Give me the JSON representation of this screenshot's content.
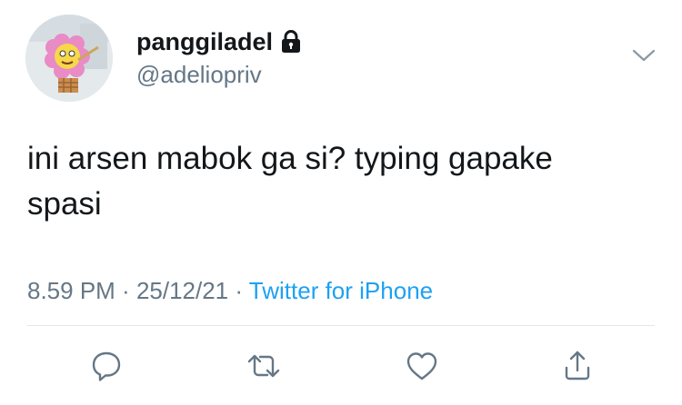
{
  "tweet": {
    "display_name": "panggiladel",
    "username": "@adeliopriv",
    "text_line1": "ini arsen mabok ga si? typing gapake",
    "text_line2": "spasi",
    "time": "8.59 PM",
    "date": "25/12/21",
    "separator": " · ",
    "source": "Twitter for iPhone",
    "account_locked": true
  },
  "icons": {
    "lock": "lock-icon",
    "menu": "chevron-down-icon",
    "reply": "reply-icon",
    "retweet": "retweet-icon",
    "like": "heart-icon",
    "share": "share-icon"
  },
  "colors": {
    "text": "#14171a",
    "secondary": "#657786",
    "link": "#1da1f2",
    "divider": "#e1e8ed"
  }
}
